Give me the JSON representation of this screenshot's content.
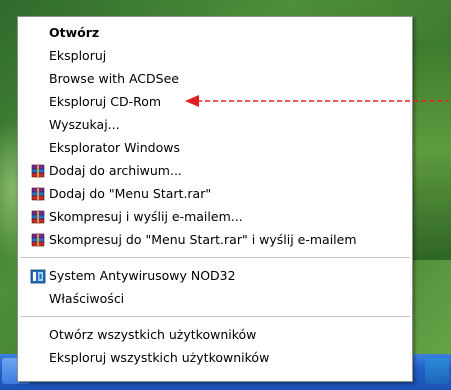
{
  "menu": {
    "items": [
      {
        "label": "Otwórz"
      },
      {
        "label": "Eksploruj"
      },
      {
        "label": "Browse with ACDSee"
      },
      {
        "label": "Eksploruj CD-Rom"
      },
      {
        "label": "Wyszukaj..."
      },
      {
        "label": "Eksplorator Windows"
      },
      {
        "label": "Dodaj do archiwum...",
        "icon": "winrar-icon"
      },
      {
        "label": "Dodaj do \"Menu Start.rar\"",
        "icon": "winrar-icon"
      },
      {
        "label": "Skompresuj i wyślij e-mailem...",
        "icon": "winrar-icon"
      },
      {
        "label": "Skompresuj do \"Menu Start.rar\" i wyślij e-mailem",
        "icon": "winrar-icon"
      },
      {
        "label": "System Antywirusowy NOD32",
        "icon": "nod32-icon"
      },
      {
        "label": "Właściwości"
      },
      {
        "label": "Otwórz wszystkich użytkowników"
      },
      {
        "label": "Eksploruj wszystkich użytkowników"
      }
    ]
  },
  "annotation": {
    "arrow_color": "#e02020"
  }
}
